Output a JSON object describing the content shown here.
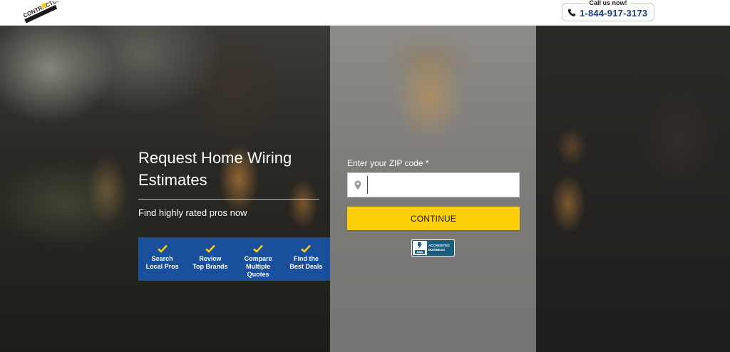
{
  "header": {
    "logo_text": "CONTRACTORS.COM",
    "call_label": "Call us now!",
    "phone": "1-844-917-3173"
  },
  "hero": {
    "headline": "Request Home Wiring Estimates",
    "subline": "Find highly rated pros now",
    "features": [
      {
        "line1": "Search",
        "line2": "Local Pros"
      },
      {
        "line1": "Review",
        "line2": "Top Brands"
      },
      {
        "line1": "Compare",
        "line2": "Multiple Quotes"
      },
      {
        "line1": "Find the",
        "line2": "Best Deals"
      }
    ]
  },
  "form": {
    "zip_label": "Enter your ZIP code *",
    "zip_value": "",
    "zip_placeholder": "",
    "continue_label": "CONTINUE"
  },
  "badge": {
    "logo_text": "BBB",
    "line1": "ACCREDITED",
    "line2": "BUSINESS"
  },
  "colors": {
    "brand_blue": "#1a4f9c",
    "accent_yellow": "#fdcf08",
    "phone_blue": "#163f82"
  }
}
